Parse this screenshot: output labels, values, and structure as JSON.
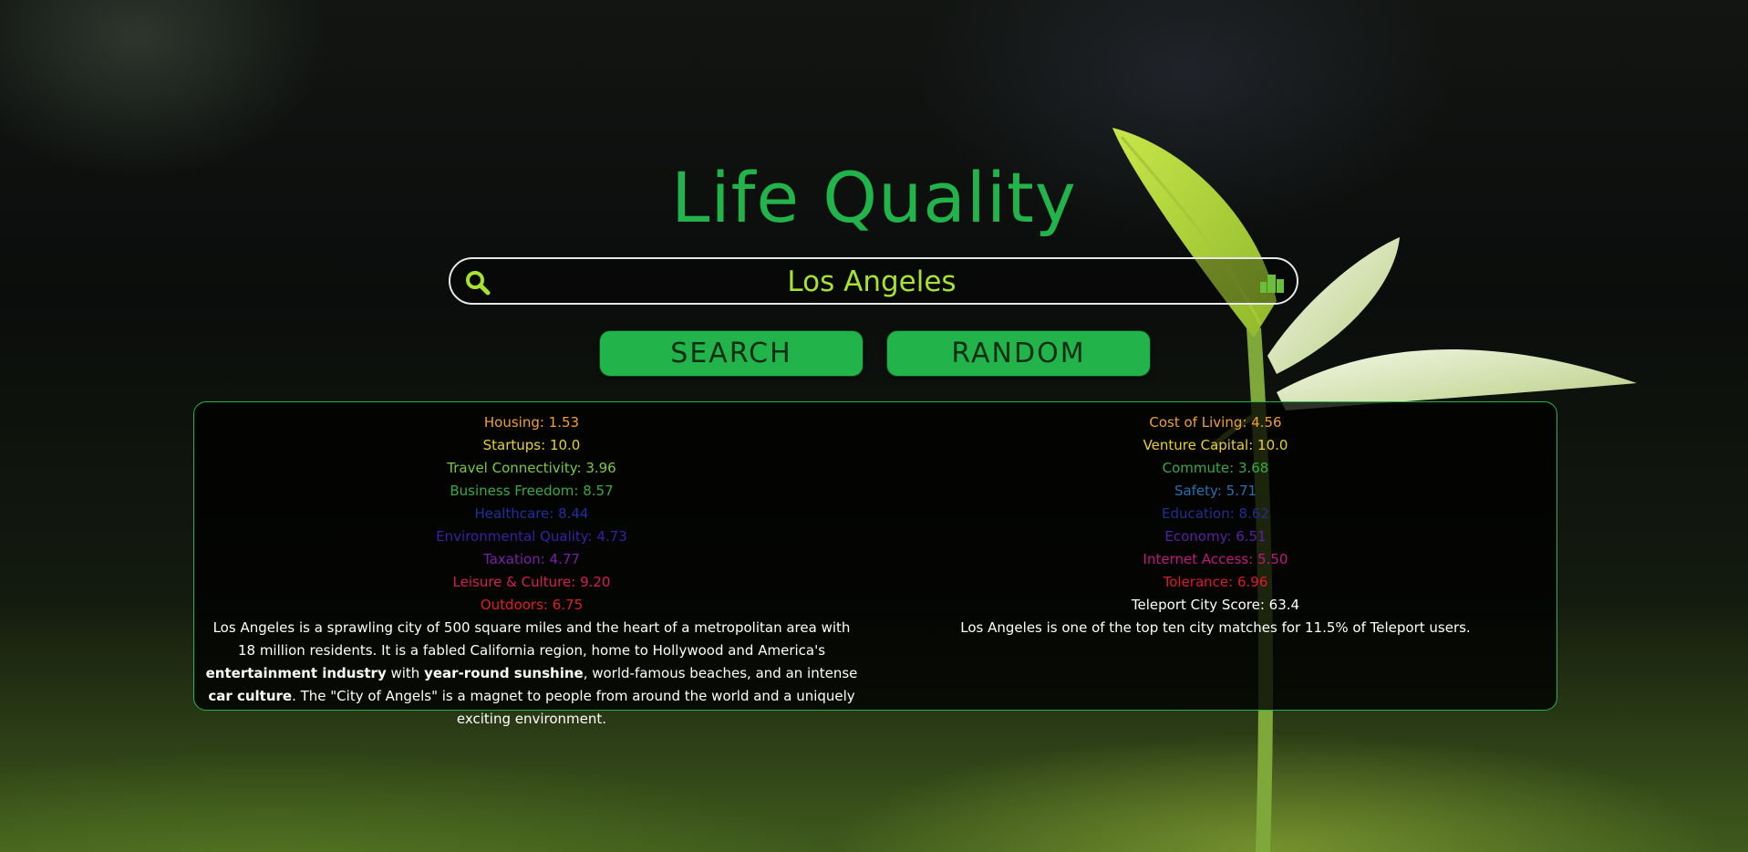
{
  "app": {
    "title": "Life Quality"
  },
  "search": {
    "value": "Los Angeles",
    "search_icon": "search-icon",
    "city_icon": "city-icon"
  },
  "buttons": {
    "search_label": "SEARCH",
    "random_label": "RANDOM"
  },
  "colors": {
    "accent": "#22b34b",
    "input_text": "#a6e22e",
    "stat_orange": "#f0a030",
    "stat_yellow": "#e8d030",
    "stat_lime": "#7ac943",
    "stat_green": "#3aa845",
    "stat_teal": "#2a6fb0",
    "stat_blue": "#1e2fa0",
    "stat_indigo": "#3a1fa8",
    "stat_purple": "#7a1fa8",
    "stat_magenta": "#c0185e",
    "stat_red": "#d81c2c",
    "stat_red2": "#e02020"
  },
  "stats_left": [
    {
      "label": "Housing: 1.53",
      "color": "#f0a030"
    },
    {
      "label": "Startups: 10.0",
      "color": "#e8d030"
    },
    {
      "label": "Travel Connectivity: 3.96",
      "color": "#7ac943"
    },
    {
      "label": "Business Freedom: 8.57",
      "color": "#3aa845"
    },
    {
      "label": "Healthcare: 8.44",
      "color": "#1e2fa0"
    },
    {
      "label": "Environmental Quality: 4.73",
      "color": "#3a1fa8"
    },
    {
      "label": "Taxation: 4.77",
      "color": "#7a1fa8"
    },
    {
      "label": "Leisure & Culture: 9.20",
      "color": "#d81c5a"
    },
    {
      "label": "Outdoors: 6.75",
      "color": "#e02020"
    }
  ],
  "stats_right": [
    {
      "label": "Cost of Living: 4.56",
      "color": "#f0a030"
    },
    {
      "label": "Venture Capital: 10.0",
      "color": "#e8d030"
    },
    {
      "label": "Commute: 3.68",
      "color": "#3aa845"
    },
    {
      "label": "Safety: 5.71",
      "color": "#2a6fb0"
    },
    {
      "label": "Education: 8.62",
      "color": "#1e2f90"
    },
    {
      "label": "Economy: 6.51",
      "color": "#5a1fa8"
    },
    {
      "label": "Internet Access: 5.50",
      "color": "#c0187e"
    },
    {
      "label": "Tolerance: 6.96",
      "color": "#e0182c"
    }
  ],
  "teleport_score": "Teleport City Score: 63.4",
  "teleport_note": "Los Angeles is one of the top ten city matches for 11.5% of Teleport users.",
  "summary": {
    "part1": "Los Angeles is a sprawling city of 500 square miles and the heart of a metropolitan area with 18 million residents. It is a fabled California region, home to Hollywood and America's ",
    "bold1": "entertainment industry",
    "part2": " with ",
    "bold2": "year-round sunshine",
    "part3": ", world-famous beaches, and an intense ",
    "bold3": "car culture",
    "part4": ". The \"City of Angels\" is a magnet to people from around the world and a uniquely exciting environment."
  }
}
